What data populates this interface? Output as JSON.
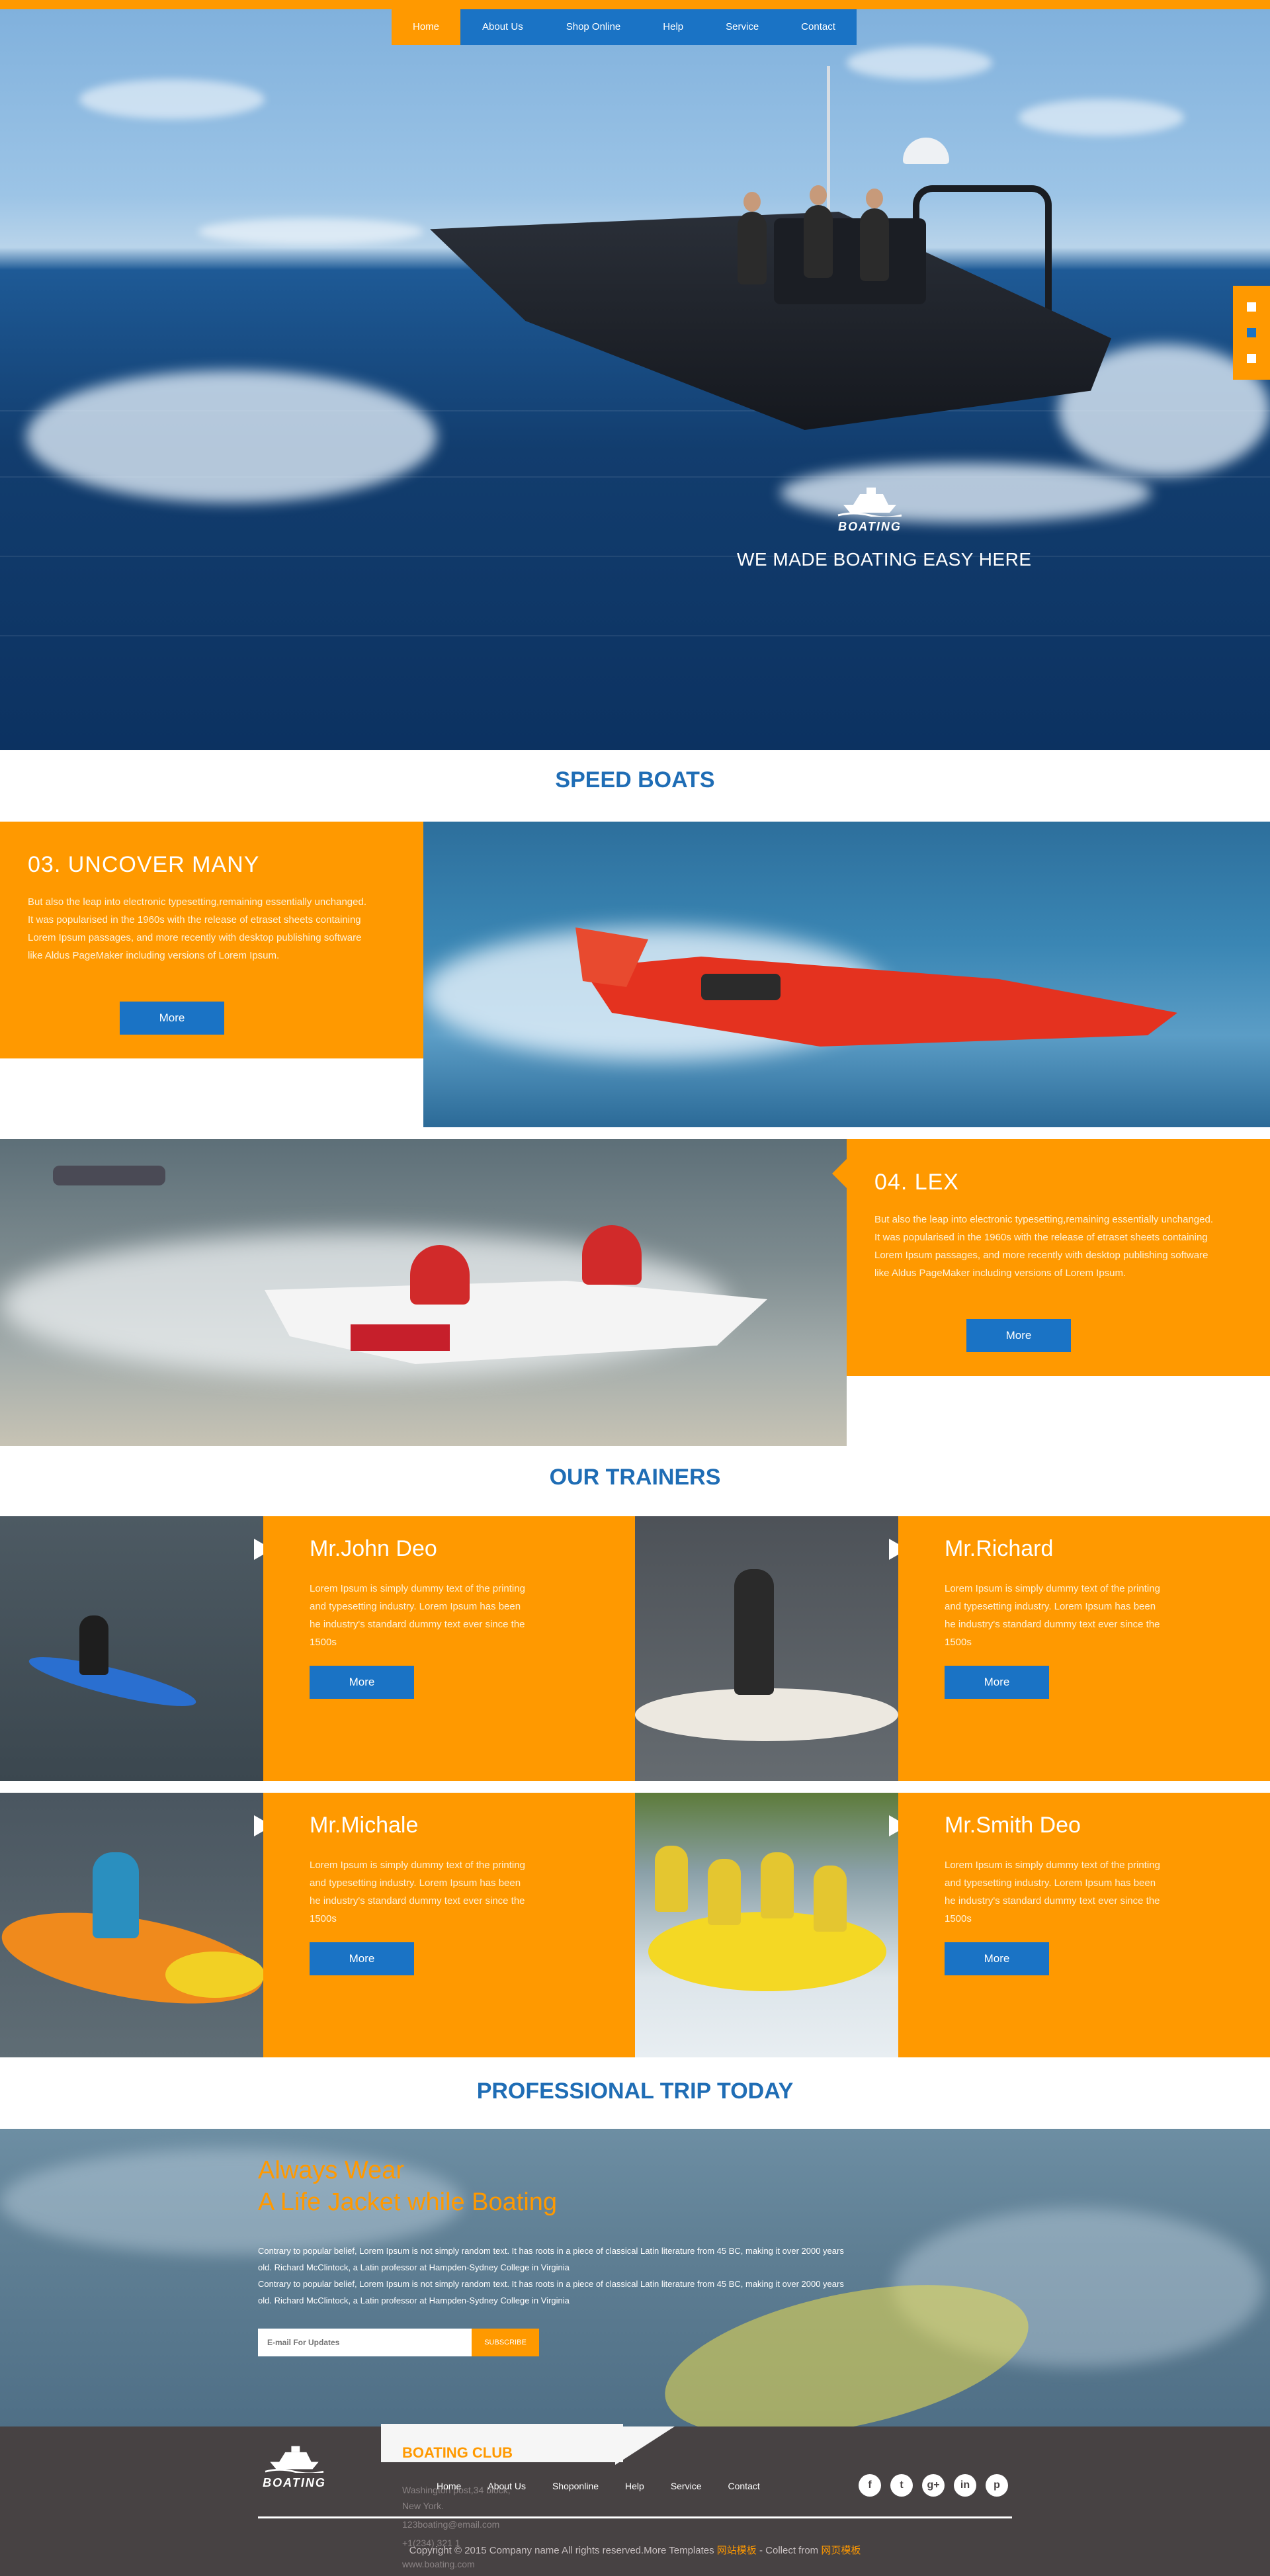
{
  "nav": {
    "items": [
      "Home",
      "About Us",
      "Shop Online",
      "Help",
      "Service",
      "Contact"
    ],
    "active": "Home"
  },
  "hero": {
    "logo_text": "BOATING",
    "tagline": "WE MADE BOATING EASY HERE"
  },
  "speed_boats": {
    "title": "SPEED BOATS",
    "features": [
      {
        "heading": "03. UNCOVER MANY",
        "text": "But also the leap into electronic typesetting,remaining essentially unchanged. It was popularised in the 1960s with the release of etraset sheets containing Lorem Ipsum passages, and more recently with desktop publishing software like Aldus PageMaker including versions of Lorem Ipsum.",
        "button": "More"
      },
      {
        "heading": "04. LEX",
        "text": "But also the leap into electronic typesetting,remaining essentially unchanged. It was popularised in the 1960s with the release of etraset sheets containing Lorem Ipsum passages, and more recently with desktop publishing software like Aldus PageMaker including versions of Lorem Ipsum.",
        "button": "More"
      }
    ]
  },
  "trainers": {
    "title": "OUR TRAINERS",
    "items": [
      {
        "name": "Mr.John Deo",
        "text": "Lorem Ipsum is simply dummy text of the printing and typesetting industry. Lorem Ipsum has been he industry's standard dummy text ever since the 1500s",
        "button": "More"
      },
      {
        "name": "Mr.Richard",
        "text": "Lorem Ipsum is simply dummy text of the printing and typesetting industry. Lorem Ipsum has been he industry's standard dummy text ever since the 1500s",
        "button": "More"
      },
      {
        "name": "Mr.Michale",
        "text": "Lorem Ipsum is simply dummy text of the printing and typesetting industry. Lorem Ipsum has been he industry's standard dummy text ever since the 1500s",
        "button": "More"
      },
      {
        "name": "Mr.Smith Deo",
        "text": "Lorem Ipsum is simply dummy text of the printing and typesetting industry. Lorem Ipsum has been he industry's standard dummy text ever since the 1500s",
        "button": "More"
      }
    ]
  },
  "trip": {
    "title": "PROFESSIONAL TRIP TODAY",
    "heading_line1": "Always Wear",
    "heading_line2": "A Life Jacket while Boating",
    "para1": "Contrary to popular belief, Lorem Ipsum is not simply random text. It has roots in a piece of classical Latin literature from 45 BC, making it over 2000 years old. Richard McClintock, a Latin professor at Hampden-Sydney College in Virginia",
    "para2": "Contrary to popular belief, Lorem Ipsum is not simply random text. It has roots in a piece of classical Latin literature from 45 BC, making it over 2000 years old. Richard McClintock, a Latin professor at Hampden-Sydney College in Virginia",
    "email_placeholder": "E-mail For Updates",
    "subscribe": "SUBSCRIBE"
  },
  "footer": {
    "logo_text": "BOATING",
    "club_title": "BOATING CLUB",
    "address1": "Washington post,34 block,",
    "address2": "New York.",
    "email": "123boating@email.com",
    "phone": "+1(234) 321 1",
    "website": "www.boating.com",
    "nav": [
      "Home",
      "About Us",
      "Shoponline",
      "Help",
      "Service",
      "Contact"
    ],
    "social": [
      "f",
      "t",
      "g+",
      "in",
      "p"
    ],
    "copyright_pre": "Copyright © 2015 Company name All rights reserved.More Templates",
    "copyright_link1": "网站模板",
    "copyright_mid": "- Collect from",
    "copyright_link2": "网页模板"
  },
  "colors": {
    "orange": "#ff9900",
    "blue": "#1a73c5",
    "title_blue": "#1f6db5",
    "footer_bg": "#474243"
  }
}
